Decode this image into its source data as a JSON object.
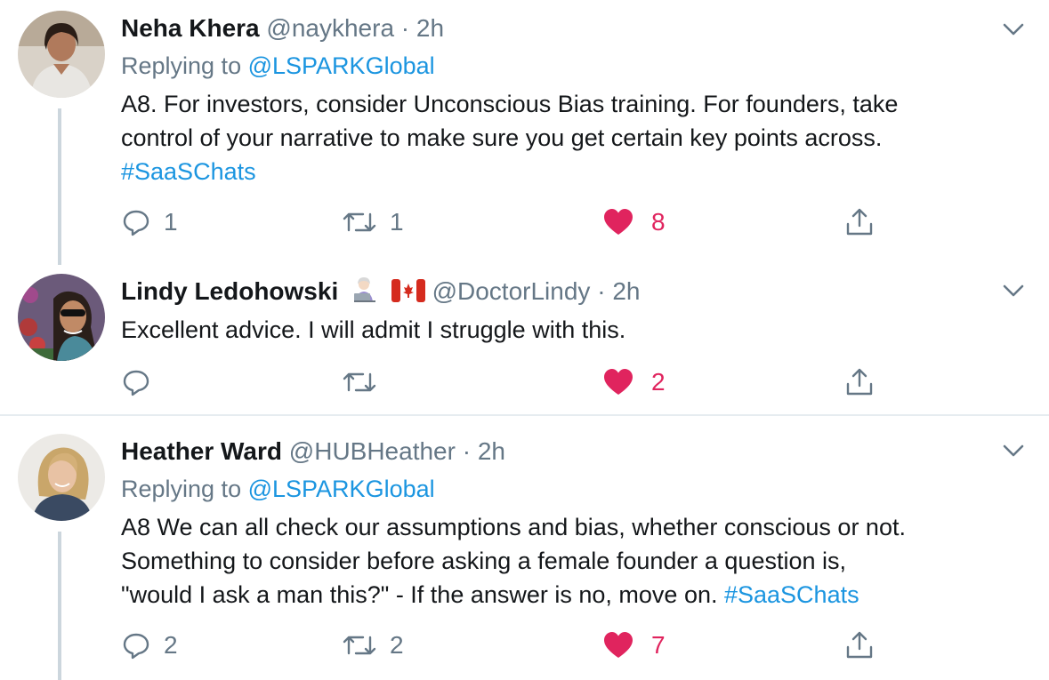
{
  "tweets": [
    {
      "name": "Neha Khera",
      "handle": "@naykhera",
      "dot": "·",
      "time": "2h",
      "replying_label": "Replying to",
      "replying_to": "@LSPARKGlobal",
      "text_lines": [
        "A8. For investors, consider Unconscious Bias training. For founders, take",
        "control of your narrative to make sure you get certain key points across."
      ],
      "hashtag": "#SaaSChats",
      "replies": "1",
      "retweets": "1",
      "likes": "8"
    },
    {
      "name": "Lindy Ledohowski",
      "handle": "@DoctorLindy",
      "dot": "·",
      "time": "2h",
      "text": "Excellent advice. I will admit I struggle with this.",
      "replies": "",
      "retweets": "",
      "likes": "2"
    },
    {
      "name": "Heather Ward",
      "handle": "@HUBHeather",
      "dot": "·",
      "time": "2h",
      "replying_label": "Replying to",
      "replying_to": "@LSPARKGlobal",
      "text_lines": [
        "A8 We can all check our assumptions and bias, whether conscious or not.",
        "Something to consider before asking a female founder a question is,",
        "\"would I ask a man this?\" - If the answer is no, move on. "
      ],
      "hashtag": "#SaaSChats",
      "replies": "2",
      "retweets": "2",
      "likes": "7"
    }
  ],
  "colors": {
    "like": "#e0245e",
    "link": "#1b95e0",
    "muted": "#657786",
    "thread": "#ccd6dd"
  }
}
